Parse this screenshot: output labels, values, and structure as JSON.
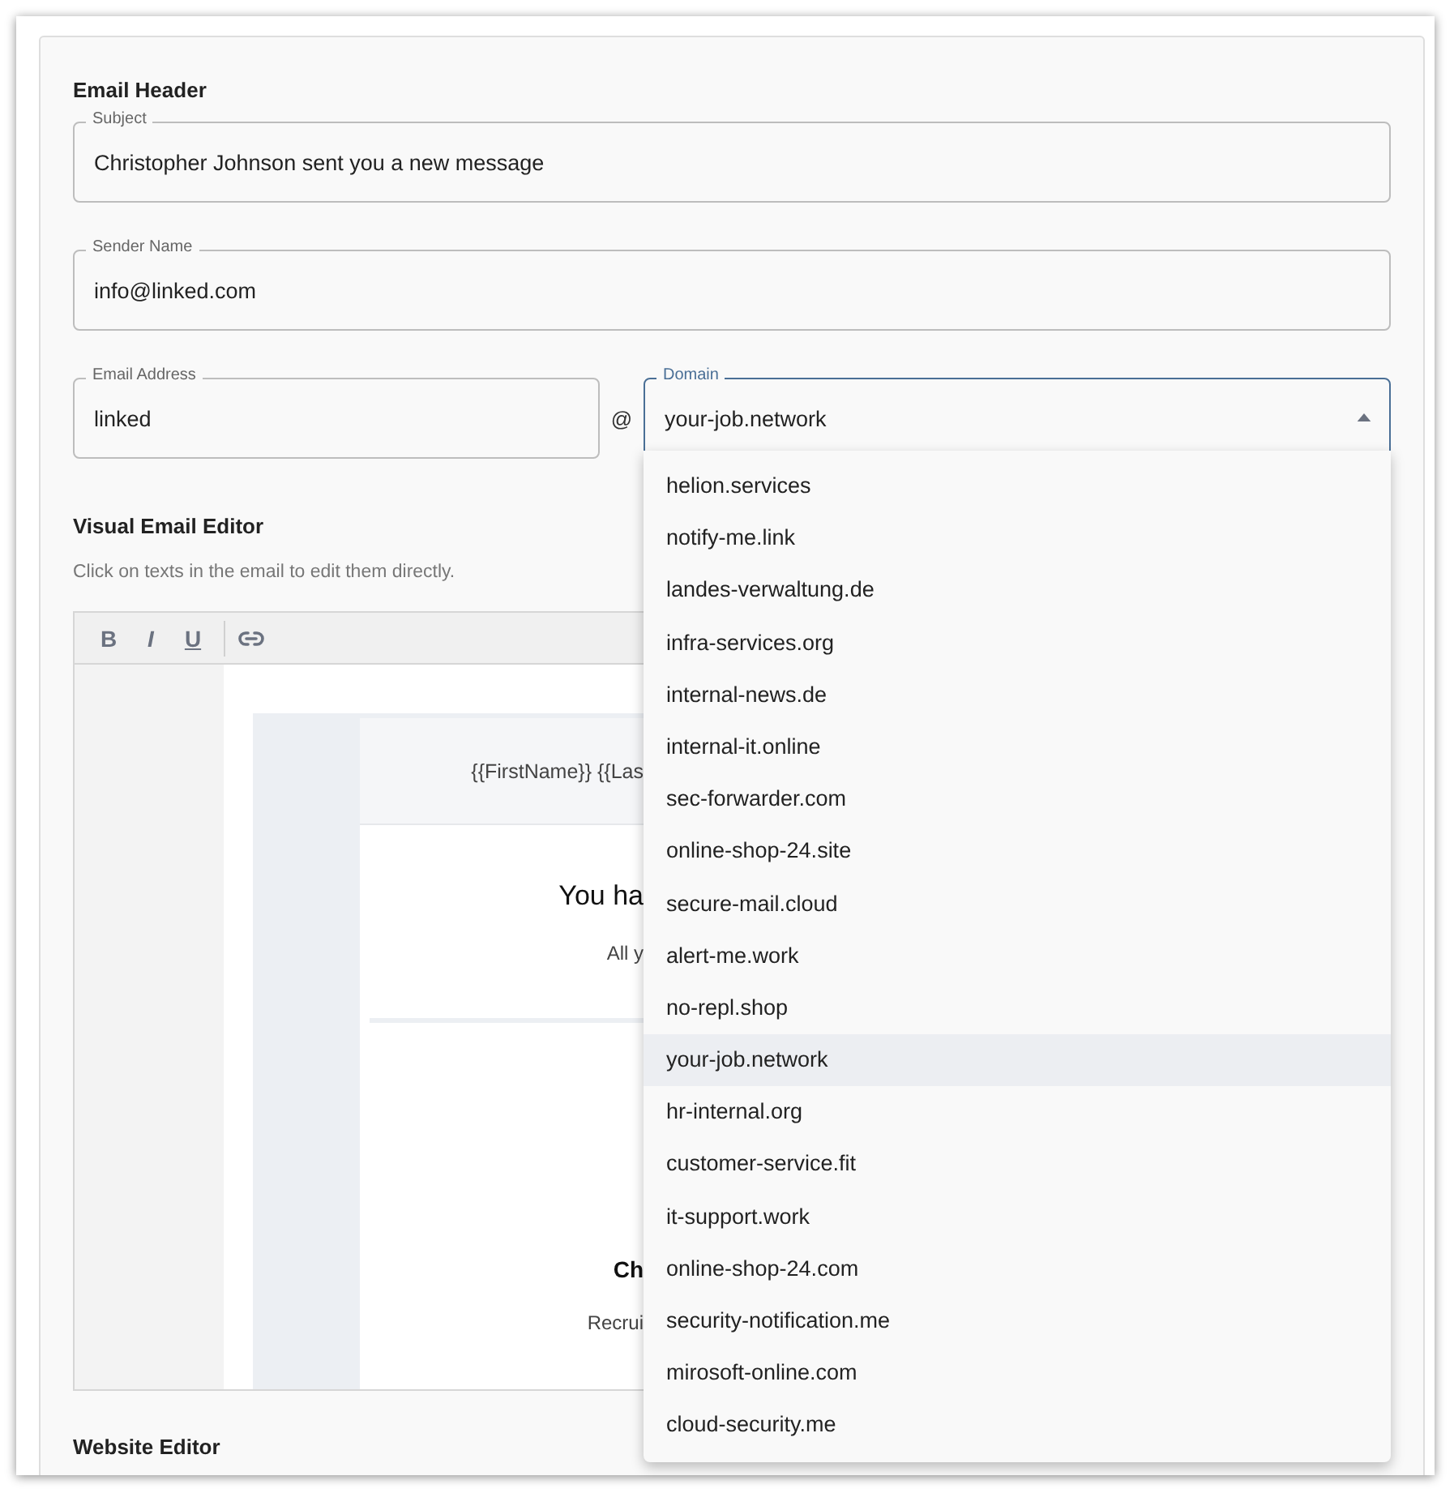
{
  "email_header": {
    "title": "Email Header",
    "fields": [
      {
        "label": "Subject",
        "value": "Christopher Johnson sent you a new message"
      },
      {
        "label": "Sender Name",
        "value": "info@linked.com"
      }
    ],
    "address": {
      "label": "Email Address",
      "value": "linked"
    },
    "at_sign": "@",
    "domain": {
      "label": "Domain",
      "value": "your-job.network",
      "expanded": true,
      "options": [
        {
          "label": "helion.services",
          "selected": false
        },
        {
          "label": "notify-me.link",
          "selected": false
        },
        {
          "label": "landes-verwaltung.de",
          "selected": false
        },
        {
          "label": "infra-services.org",
          "selected": false
        },
        {
          "label": "internal-news.de",
          "selected": false
        },
        {
          "label": "internal-it.online",
          "selected": false
        },
        {
          "label": "sec-forwarder.com",
          "selected": false
        },
        {
          "label": "online-shop-24.site",
          "selected": false
        },
        {
          "label": "secure-mail.cloud",
          "selected": false
        },
        {
          "label": "alert-me.work",
          "selected": false
        },
        {
          "label": "no-repl.shop",
          "selected": false
        },
        {
          "label": "your-job.network",
          "selected": true
        },
        {
          "label": "hr-internal.org",
          "selected": false
        },
        {
          "label": "customer-service.fit",
          "selected": false
        },
        {
          "label": "it-support.work",
          "selected": false
        },
        {
          "label": "online-shop-24.com",
          "selected": false
        },
        {
          "label": "security-notification.me",
          "selected": false
        },
        {
          "label": "mirosoft-online.com",
          "selected": false
        },
        {
          "label": "cloud-security.me",
          "selected": false
        }
      ]
    }
  },
  "visual_email_editor": {
    "title": "Visual Email Editor",
    "hint": "Click on texts in the email to edit them directly.",
    "toolbar": [
      {
        "kind": "bold",
        "label": "B"
      },
      {
        "kind": "italic",
        "label": "I"
      },
      {
        "kind": "underline",
        "label": "U"
      },
      {
        "kind": "link"
      }
    ],
    "preview": {
      "header": "{{FirstName}} {{Las",
      "headline": "You ha",
      "intro": "All y",
      "name": "Ch",
      "role": "Recrui"
    }
  },
  "website_editor": {
    "title": "Website Editor"
  }
}
